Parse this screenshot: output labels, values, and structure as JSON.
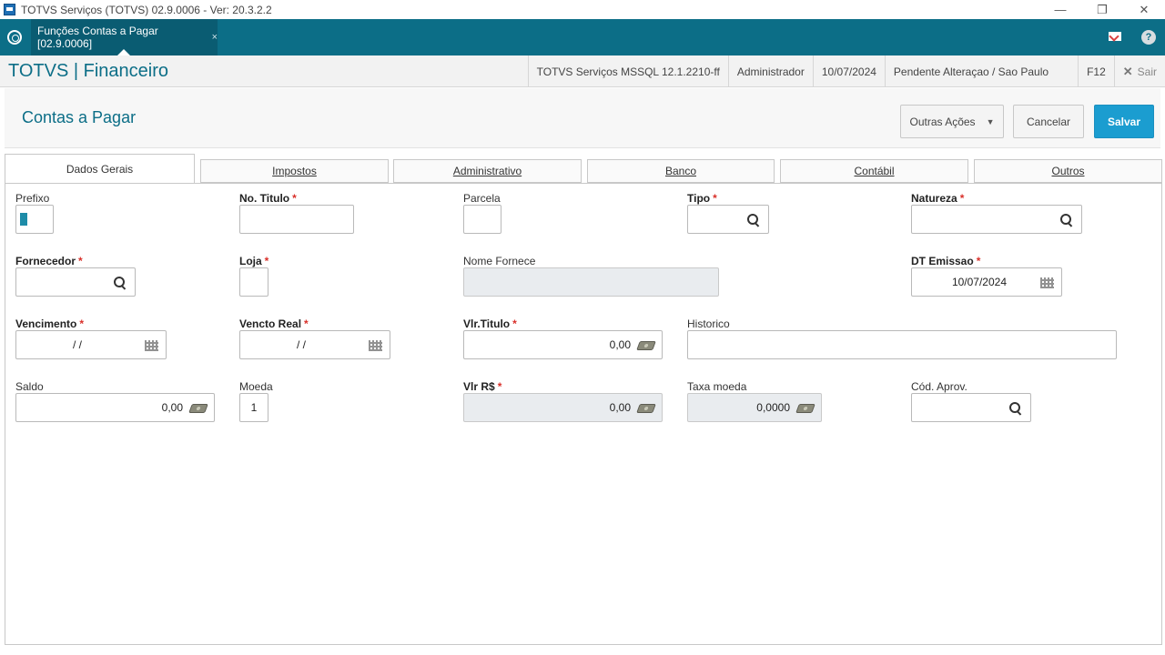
{
  "window": {
    "title": "TOTVS Serviços (TOTVS) 02.9.0006 - Ver: 20.3.2.2"
  },
  "appbar": {
    "tab_label": "Funções Contas a Pagar [02.9.0006]",
    "tab_close": "×",
    "help": "?"
  },
  "module": {
    "brand": "TOTVS | Financeiro",
    "environment": "TOTVS Serviços MSSQL 12.1.2210-ff",
    "user": "Administrador",
    "date": "10/07/2024",
    "branch": "Pendente Alteraçao / Sao Paulo",
    "shortcut": "F12",
    "exit_icon": "✕",
    "exit_label": "Sair"
  },
  "page": {
    "title": "Contas a Pagar",
    "other_actions": "Outras Ações",
    "cancel": "Cancelar",
    "save": "Salvar"
  },
  "tabs": [
    "Dados Gerais",
    "Impostos",
    "Administrativo",
    "Banco",
    "Contábil",
    "Outros"
  ],
  "form": {
    "prefixo": {
      "label": "Prefixo",
      "value": ""
    },
    "no_titulo": {
      "label": "No. Titulo",
      "value": ""
    },
    "parcela": {
      "label": "Parcela",
      "value": ""
    },
    "tipo": {
      "label": "Tipo",
      "value": ""
    },
    "natureza": {
      "label": "Natureza",
      "value": ""
    },
    "fornecedor": {
      "label": "Fornecedor",
      "value": ""
    },
    "loja": {
      "label": "Loja",
      "value": ""
    },
    "nome_fornece": {
      "label": "Nome Fornece",
      "value": ""
    },
    "dt_emissao": {
      "label": "DT Emissao",
      "value": "10/07/2024"
    },
    "vencimento": {
      "label": "Vencimento",
      "value": "/ /"
    },
    "vencto_real": {
      "label": "Vencto Real",
      "value": "/ /"
    },
    "vlr_titulo": {
      "label": "Vlr.Titulo",
      "value": "0,00"
    },
    "historico": {
      "label": "Historico",
      "value": ""
    },
    "saldo": {
      "label": "Saldo",
      "value": "0,00"
    },
    "moeda": {
      "label": "Moeda",
      "value": "1"
    },
    "vlr_rs": {
      "label": "Vlr R$",
      "value": "0,00"
    },
    "taxa_moeda": {
      "label": "Taxa moeda",
      "value": "0,0000"
    },
    "cod_aprov": {
      "label": "Cód. Aprov.",
      "value": ""
    },
    "required_mark": "*"
  }
}
